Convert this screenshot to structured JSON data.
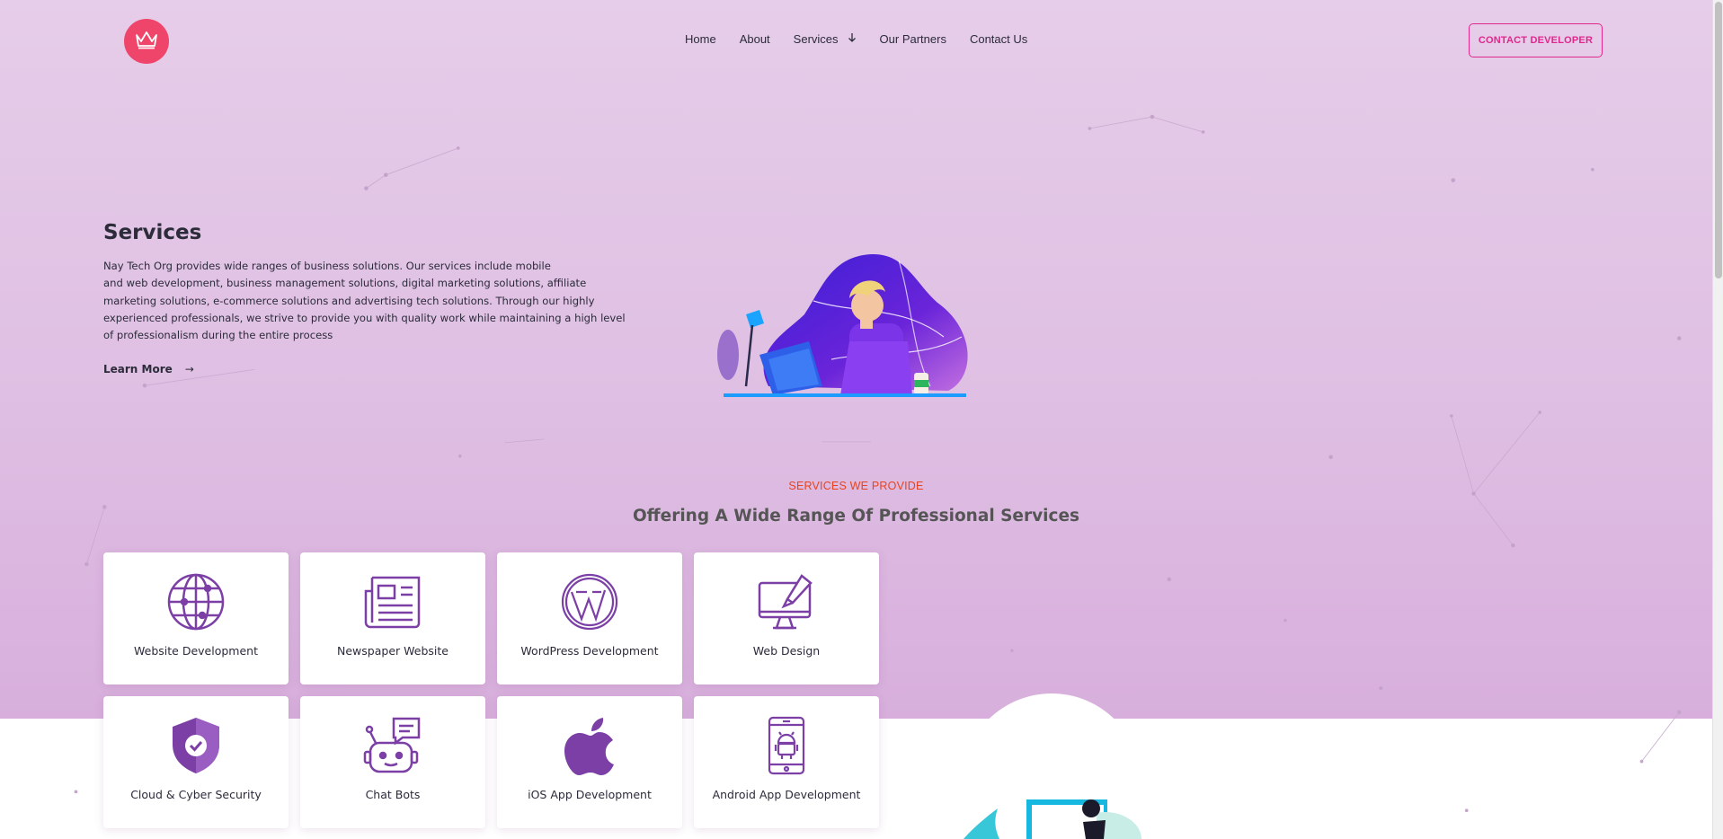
{
  "header": {
    "logo_icon": "crown-icon",
    "nav": [
      {
        "label": "Home"
      },
      {
        "label": "About"
      },
      {
        "label": "Services"
      },
      {
        "label": "Our Partners"
      },
      {
        "label": "Contact Us"
      }
    ],
    "contact_button": "CONTACT DEVELOPER"
  },
  "hero": {
    "title": "Services",
    "description_lines": [
      "Nay Tech Org provides wide ranges of business solutions. Our services include mobile",
      "and web development, business management solutions, digital marketing solutions, affiliate",
      "marketing solutions, e-commerce solutions and advertising tech solutions. Through our highly",
      "experienced professionals, we strive to provide you with quality work while maintaining a high level",
      "of professionalism during the entire process"
    ],
    "learn_more": "Learn More",
    "learn_more_arrow": "→"
  },
  "services_section": {
    "kicker": "SERVICES WE PROVIDE",
    "title": "Offering A Wide Range Of Professional Services",
    "cards": [
      {
        "label": "Website Development",
        "icon": "globe-icon"
      },
      {
        "label": "Newspaper Website",
        "icon": "newspaper-icon"
      },
      {
        "label": "WordPress Development",
        "icon": "wordpress-icon"
      },
      {
        "label": "Web Design",
        "icon": "monitor-brush-icon"
      },
      {
        "label": "Cloud & Cyber Security",
        "icon": "shield-check-icon"
      },
      {
        "label": "Chat Bots",
        "icon": "robot-chat-icon"
      },
      {
        "label": "iOS App Development",
        "icon": "apple-icon"
      },
      {
        "label": "Android App Development",
        "icon": "android-phone-icon"
      }
    ]
  },
  "colors": {
    "accent": "#e0288c",
    "kicker": "#e8431f",
    "logo": "#f0456a",
    "icon_purple": "#7b3fa6"
  }
}
